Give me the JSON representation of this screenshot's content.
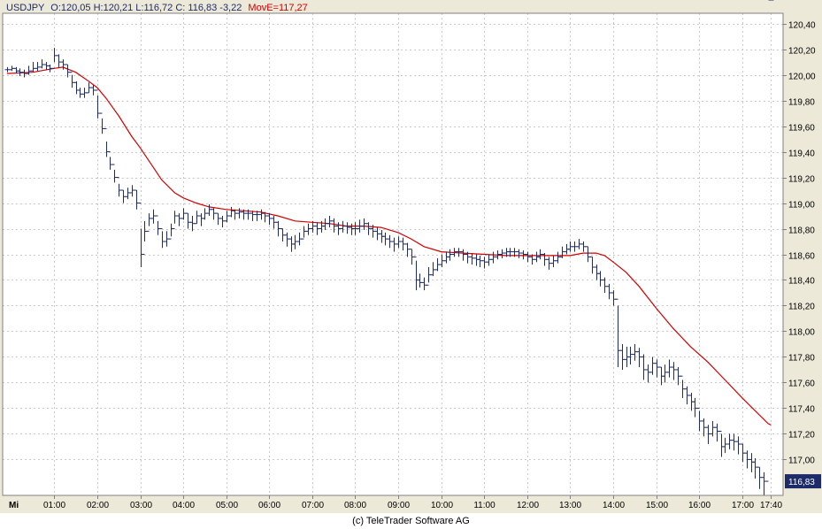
{
  "header": {
    "symbol": "USDJPY",
    "ohlc_text": "O:120,05 H:120,21 L:116,72 C: 116,83 -3,22",
    "indicator_text": "MovE=117,27"
  },
  "footer": {
    "copyright": "(c) TeleTrader Software AG"
  },
  "colors": {
    "background": "#ffffff",
    "frame": "#ece9d8",
    "grid": "#c8c8c8",
    "bars": "#1e2b6b",
    "moving_average": "#d00000",
    "header_text": "#1e2b6b",
    "indicator_text": "#d00000"
  },
  "chart_data": {
    "type": "ohlc_bar",
    "title": "USDJPY",
    "day_label": "Mi",
    "x_tick_labels": [
      "01:00",
      "02:00",
      "03:00",
      "04:00",
      "05:00",
      "06:00",
      "07:00",
      "08:00",
      "09:00",
      "10:00",
      "11:00",
      "12:00",
      "13:00",
      "14:00",
      "15:00",
      "16:00",
      "17:00",
      "17:40"
    ],
    "x_tick_hours": [
      1,
      2,
      3,
      4,
      5,
      6,
      7,
      8,
      9,
      10,
      11,
      12,
      13,
      14,
      15,
      16,
      17,
      17.667
    ],
    "x_range_hours": [
      -0.2,
      17.95
    ],
    "y_tick_labels": [
      "117,00",
      "117,20",
      "117,40",
      "117,60",
      "117,80",
      "118,00",
      "118,20",
      "118,40",
      "118,60",
      "118,80",
      "119,00",
      "119,20",
      "119,40",
      "119,60",
      "119,80",
      "120,00",
      "120,20",
      "120,40"
    ],
    "y_ticks": [
      117.0,
      117.2,
      117.4,
      117.6,
      117.8,
      118.0,
      118.2,
      118.4,
      118.6,
      118.8,
      119.0,
      119.2,
      119.4,
      119.6,
      119.8,
      120.0,
      120.2,
      120.4
    ],
    "ylim": [
      116.72,
      120.48
    ],
    "last_value_label": "116,83",
    "last_value": 116.83,
    "grid": true,
    "series": [
      {
        "name": "USDJPY",
        "kind": "price",
        "x_hours": [
          -0.1,
          0.0,
          0.1,
          0.2,
          0.3,
          0.4,
          0.5,
          0.6,
          0.7,
          0.8,
          0.9,
          1.0,
          1.1,
          1.2,
          1.3,
          1.4,
          1.5,
          1.6,
          1.7,
          1.8,
          1.9,
          2.0,
          2.1,
          2.2,
          2.3,
          2.4,
          2.5,
          2.6,
          2.7,
          2.8,
          2.9,
          3.0,
          3.1,
          3.2,
          3.3,
          3.4,
          3.5,
          3.6,
          3.7,
          3.8,
          3.9,
          4.0,
          4.1,
          4.2,
          4.3,
          4.4,
          4.5,
          4.6,
          4.7,
          4.8,
          4.9,
          5.0,
          5.1,
          5.2,
          5.3,
          5.4,
          5.5,
          5.6,
          5.7,
          5.8,
          5.9,
          6.0,
          6.1,
          6.2,
          6.3,
          6.4,
          6.5,
          6.6,
          6.7,
          6.8,
          6.9,
          7.0,
          7.1,
          7.2,
          7.3,
          7.4,
          7.5,
          7.6,
          7.7,
          7.8,
          7.9,
          8.0,
          8.1,
          8.2,
          8.3,
          8.4,
          8.5,
          8.6,
          8.7,
          8.8,
          8.9,
          9.0,
          9.1,
          9.2,
          9.3,
          9.4,
          9.5,
          9.6,
          9.7,
          9.8,
          9.9,
          10.0,
          10.1,
          10.2,
          10.3,
          10.4,
          10.5,
          10.6,
          10.7,
          10.8,
          10.9,
          11.0,
          11.1,
          11.2,
          11.3,
          11.4,
          11.5,
          11.6,
          11.7,
          11.8,
          11.9,
          12.0,
          12.1,
          12.2,
          12.3,
          12.4,
          12.5,
          12.6,
          12.7,
          12.8,
          12.9,
          13.0,
          13.1,
          13.2,
          13.3,
          13.4,
          13.5,
          13.6,
          13.7,
          13.8,
          13.9,
          14.0,
          14.1,
          14.2,
          14.3,
          14.4,
          14.5,
          14.6,
          14.7,
          14.8,
          14.9,
          15.0,
          15.1,
          15.2,
          15.3,
          15.4,
          15.5,
          15.6,
          15.7,
          15.8,
          15.9,
          16.0,
          16.1,
          16.2,
          16.3,
          16.4,
          16.5,
          16.6,
          16.7,
          16.8,
          16.9,
          17.0,
          17.1,
          17.2,
          17.3,
          17.4,
          17.5,
          17.6,
          17.667
        ],
        "close": [
          120.04,
          120.05,
          120.03,
          120.02,
          120.01,
          120.03,
          120.05,
          120.06,
          120.08,
          120.07,
          120.05,
          120.15,
          120.1,
          120.08,
          120.02,
          119.94,
          119.88,
          119.85,
          119.86,
          119.9,
          119.88,
          119.7,
          119.58,
          119.4,
          119.3,
          119.2,
          119.1,
          119.05,
          119.08,
          119.1,
          119.0,
          118.6,
          118.78,
          118.88,
          118.9,
          118.8,
          118.7,
          118.72,
          118.8,
          118.9,
          118.88,
          118.92,
          118.85,
          118.84,
          118.9,
          118.88,
          118.92,
          118.95,
          118.92,
          118.88,
          118.86,
          118.9,
          118.94,
          118.92,
          118.93,
          118.92,
          118.92,
          118.91,
          118.91,
          118.92,
          118.9,
          118.88,
          118.85,
          118.8,
          118.75,
          118.72,
          118.68,
          118.7,
          118.72,
          118.78,
          118.8,
          118.82,
          118.8,
          118.82,
          118.84,
          118.86,
          118.82,
          118.8,
          118.82,
          118.81,
          118.8,
          118.8,
          118.82,
          118.84,
          118.8,
          118.78,
          118.76,
          118.74,
          118.72,
          118.7,
          118.68,
          118.7,
          118.68,
          118.64,
          118.58,
          118.4,
          118.38,
          118.36,
          118.44,
          118.48,
          118.52,
          118.55,
          118.58,
          118.6,
          118.62,
          118.62,
          118.6,
          118.58,
          118.57,
          118.56,
          118.55,
          118.54,
          118.56,
          118.58,
          118.6,
          118.61,
          118.62,
          118.62,
          118.62,
          118.61,
          118.6,
          118.58,
          118.56,
          118.58,
          118.6,
          118.56,
          118.53,
          118.55,
          118.58,
          118.62,
          118.64,
          118.66,
          118.66,
          118.68,
          118.66,
          118.58,
          118.5,
          118.45,
          118.4,
          118.35,
          118.3,
          118.25,
          117.85,
          117.78,
          117.8,
          117.82,
          117.84,
          117.8,
          117.7,
          117.68,
          117.75,
          117.72,
          117.65,
          117.68,
          117.72,
          117.7,
          117.65,
          117.55,
          117.5,
          117.45,
          117.4,
          117.3,
          117.25,
          117.2,
          117.25,
          117.22,
          117.1,
          117.12,
          117.15,
          117.14,
          117.12,
          117.05,
          117.0,
          116.98,
          116.94,
          116.86,
          116.83
        ],
        "high": [
          120.06,
          120.07,
          120.06,
          120.05,
          120.04,
          120.07,
          120.1,
          120.1,
          120.12,
          120.1,
          120.08,
          120.21,
          120.16,
          120.12,
          120.08,
          120.0,
          119.95,
          119.9,
          119.9,
          119.94,
          119.92,
          119.84,
          119.66,
          119.48,
          119.36,
          119.26,
          119.15,
          119.1,
          119.12,
          119.14,
          119.1,
          118.8,
          118.86,
          118.92,
          118.95,
          118.86,
          118.78,
          118.78,
          118.84,
          118.94,
          118.92,
          118.96,
          118.92,
          118.9,
          118.94,
          118.92,
          118.96,
          118.99,
          118.96,
          118.92,
          118.9,
          118.94,
          118.97,
          118.95,
          118.96,
          118.95,
          118.95,
          118.94,
          118.94,
          118.95,
          118.93,
          118.92,
          118.9,
          118.86,
          118.8,
          118.77,
          118.74,
          118.75,
          118.77,
          118.82,
          118.84,
          118.86,
          118.85,
          118.86,
          118.88,
          118.9,
          118.88,
          118.85,
          118.86,
          118.85,
          118.84,
          118.85,
          118.87,
          118.88,
          118.85,
          118.83,
          118.81,
          118.79,
          118.77,
          118.75,
          118.73,
          118.74,
          118.73,
          118.69,
          118.64,
          118.55,
          118.45,
          118.42,
          118.5,
          118.54,
          118.57,
          118.6,
          118.62,
          118.64,
          118.65,
          118.65,
          118.64,
          118.62,
          118.61,
          118.6,
          118.59,
          118.58,
          118.6,
          118.62,
          118.63,
          118.64,
          118.65,
          118.65,
          118.65,
          118.64,
          118.63,
          118.62,
          118.6,
          118.62,
          118.64,
          118.61,
          118.58,
          118.59,
          118.62,
          118.66,
          118.68,
          118.7,
          118.7,
          118.72,
          118.7,
          118.66,
          118.58,
          118.52,
          118.47,
          118.42,
          118.37,
          118.32,
          118.2,
          117.9,
          117.88,
          117.88,
          117.9,
          117.87,
          117.82,
          117.74,
          117.8,
          117.78,
          117.72,
          117.74,
          117.78,
          117.76,
          117.72,
          117.62,
          117.57,
          117.52,
          117.48,
          117.38,
          117.32,
          117.27,
          117.3,
          117.28,
          117.2,
          117.17,
          117.2,
          117.2,
          117.18,
          117.12,
          117.07,
          117.05,
          117.01,
          116.94,
          116.9
        ],
        "low": [
          120.02,
          120.03,
          120.01,
          119.99,
          119.98,
          120.0,
          120.02,
          120.03,
          120.05,
          120.04,
          120.02,
          120.1,
          120.06,
          120.04,
          119.98,
          119.9,
          119.85,
          119.82,
          119.82,
          119.86,
          119.84,
          119.66,
          119.54,
          119.36,
          119.26,
          119.16,
          119.05,
          119.0,
          119.03,
          119.05,
          118.95,
          118.5,
          118.7,
          118.82,
          118.84,
          118.75,
          118.65,
          118.66,
          118.74,
          118.84,
          118.82,
          118.87,
          118.8,
          118.78,
          118.84,
          118.82,
          118.87,
          118.9,
          118.87,
          118.83,
          118.81,
          118.85,
          118.89,
          118.87,
          118.88,
          118.87,
          118.87,
          118.86,
          118.86,
          118.87,
          118.85,
          118.83,
          118.8,
          118.74,
          118.7,
          118.66,
          118.62,
          118.64,
          118.67,
          118.73,
          118.75,
          118.77,
          118.75,
          118.77,
          118.79,
          118.81,
          118.77,
          118.75,
          118.77,
          118.76,
          118.75,
          118.75,
          118.77,
          118.79,
          118.75,
          118.73,
          118.71,
          118.69,
          118.67,
          118.65,
          118.62,
          118.65,
          118.63,
          118.58,
          118.52,
          118.32,
          118.34,
          118.32,
          118.38,
          118.43,
          118.47,
          118.5,
          118.53,
          118.55,
          118.58,
          118.58,
          118.55,
          118.53,
          118.52,
          118.51,
          118.5,
          118.49,
          118.51,
          118.53,
          118.56,
          118.57,
          118.58,
          118.58,
          118.58,
          118.57,
          118.56,
          118.54,
          118.52,
          118.54,
          118.56,
          118.51,
          118.48,
          118.5,
          118.53,
          118.57,
          118.6,
          118.62,
          118.62,
          118.64,
          118.62,
          118.54,
          118.45,
          118.4,
          118.35,
          118.3,
          118.25,
          118.2,
          117.72,
          117.7,
          117.72,
          117.74,
          117.77,
          117.72,
          117.62,
          117.6,
          117.66,
          117.64,
          117.58,
          117.6,
          117.64,
          117.62,
          117.58,
          117.48,
          117.43,
          117.38,
          117.33,
          117.22,
          117.18,
          117.12,
          117.18,
          117.14,
          117.02,
          117.05,
          117.08,
          117.07,
          117.04,
          116.98,
          116.93,
          116.9,
          116.85,
          116.77,
          116.72
        ]
      },
      {
        "name": "MovE",
        "kind": "moving_average",
        "x_hours": [
          -0.1,
          0.5,
          1.0,
          1.2,
          1.5,
          1.8,
          2.0,
          2.2,
          2.5,
          2.8,
          3.0,
          3.3,
          3.5,
          3.8,
          4.0,
          4.3,
          4.6,
          5.0,
          5.4,
          5.8,
          6.2,
          6.6,
          7.0,
          7.4,
          7.8,
          8.2,
          8.6,
          9.0,
          9.3,
          9.6,
          10.0,
          10.5,
          11.0,
          11.5,
          12.0,
          12.5,
          13.0,
          13.3,
          13.6,
          13.8,
          14.0,
          14.3,
          14.6,
          15.0,
          15.4,
          15.8,
          16.2,
          16.6,
          17.0,
          17.3,
          17.6,
          17.667
        ],
        "values": [
          120.01,
          120.02,
          120.05,
          120.06,
          120.02,
          119.95,
          119.9,
          119.82,
          119.68,
          119.52,
          119.43,
          119.28,
          119.18,
          119.08,
          119.04,
          119.0,
          118.97,
          118.95,
          118.94,
          118.93,
          118.9,
          118.86,
          118.85,
          118.84,
          118.82,
          118.82,
          118.81,
          118.77,
          118.72,
          118.66,
          118.62,
          118.61,
          118.6,
          118.59,
          118.59,
          118.59,
          118.59,
          118.61,
          118.61,
          118.59,
          118.54,
          118.46,
          118.35,
          118.18,
          118.02,
          117.88,
          117.76,
          117.62,
          117.48,
          117.38,
          117.28,
          117.27
        ]
      }
    ]
  }
}
